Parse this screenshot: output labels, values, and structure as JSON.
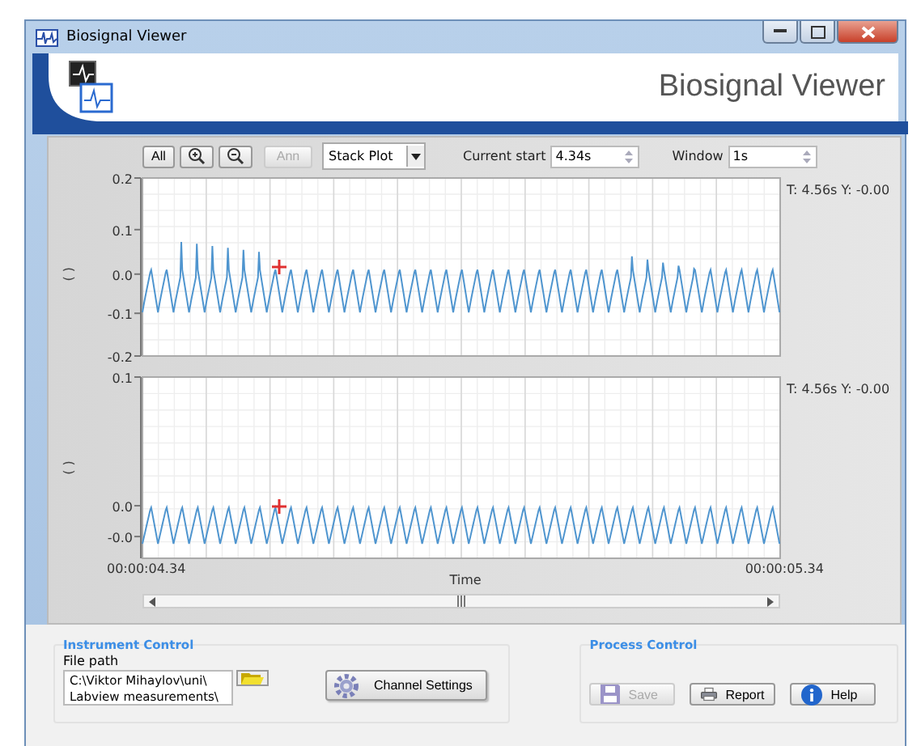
{
  "window": {
    "title": "Biosignal Viewer"
  },
  "header": {
    "title": "Biosignal Viewer"
  },
  "toolbar": {
    "buttons": [
      {
        "kind": "text",
        "label": "All",
        "disabled": false
      },
      {
        "kind": "zoom-in",
        "disabled": false
      },
      {
        "kind": "zoom-out",
        "disabled": false
      },
      {
        "kind": "text",
        "label": "Ann",
        "disabled": true
      }
    ],
    "plot_mode": "Stack Plot",
    "current_start_label": "Current start",
    "current_start": "4.34s",
    "window_label": "Window",
    "window": "1s"
  },
  "plots": [
    {
      "unit": "( )",
      "yticks": [
        "0.2",
        "0.1",
        "0.0",
        "-0.1",
        "-0.2"
      ],
      "readout": "T: 4.56s Y: -0.00"
    },
    {
      "unit": "( )",
      "yticks": [
        "0.1",
        "0.0",
        "-0.0"
      ],
      "readout": "T: 4.56s Y: -0.00"
    }
  ],
  "x_start": "00:00:04.34",
  "x_end": "00:00:05.34",
  "xlabel": "Time",
  "instrument_control": {
    "title": "Instrument Control",
    "file_path_label": "File path",
    "file_path": "C:\\Viktor Mihaylov\\uni\\ Labview measurements\\",
    "channel_settings": "Channel Settings"
  },
  "process_control": {
    "title": "Process Control",
    "buttons": [
      {
        "kind": "save",
        "label": "Save",
        "disabled": true
      },
      {
        "kind": "report",
        "label": "Report",
        "disabled": false
      },
      {
        "kind": "help",
        "label": "Help",
        "disabled": false
      }
    ]
  }
}
